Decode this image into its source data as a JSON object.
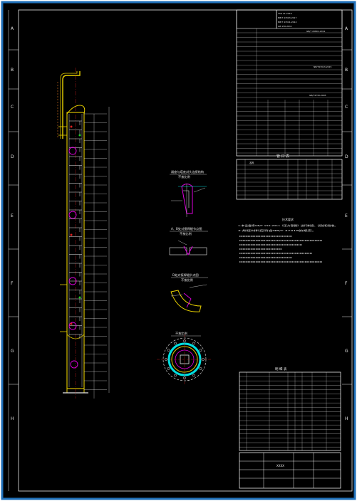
{
  "colors": {
    "background": "#000000",
    "outer_frame": "#1f6fb8",
    "line_white": "#e8e8e8",
    "line_yellow": "#e8d000",
    "line_magenta": "#e000e0",
    "line_cyan": "#00e0e0",
    "line_red": "#e02020",
    "line_green": "#20d020",
    "line_orange": "#e07a20"
  },
  "border": {
    "left_letters": [
      "A",
      "B",
      "C",
      "D",
      "E",
      "F",
      "G",
      "H"
    ],
    "right_letters": [
      "A",
      "B",
      "C",
      "D",
      "E",
      "F",
      "G",
      "H"
    ]
  },
  "spec_header": {
    "std_1": "TSG 21-2016",
    "std_2": "NB/T 47003-2017",
    "std_3": "NB/T 47041-2014",
    "std_4": "GB 150-2011"
  },
  "standard_refs": {
    "ref_1": "GB/T 20801-2011",
    "ref_2": "NB/T47013-2015",
    "ref_3": "GB/T4730-2005"
  },
  "nozzle_table": {
    "title": "管 口 表",
    "header": "名称"
  },
  "notes": {
    "title": "技术要求",
    "line_1": "1.本设备按GB/T 150-2011《压力容器》进行制造、试验和验收。",
    "line_2": "2.焊接材料应符合NB/T 47018的规定。"
  },
  "details": {
    "detail_1": {
      "title": "裙座与塔底封头连接结构",
      "scale": "不按比例"
    },
    "detail_2": {
      "title": "A、B处对接焊缝节点图",
      "scale": "不按比例"
    },
    "detail_3": {
      "title": "D处对接焊缝节点图",
      "scale": "不按比例"
    },
    "detail_4": {
      "title": "不按比例"
    }
  },
  "parts_list": {
    "title": "明 细 表"
  },
  "title_block": {
    "drawing_no": "XXXX"
  }
}
